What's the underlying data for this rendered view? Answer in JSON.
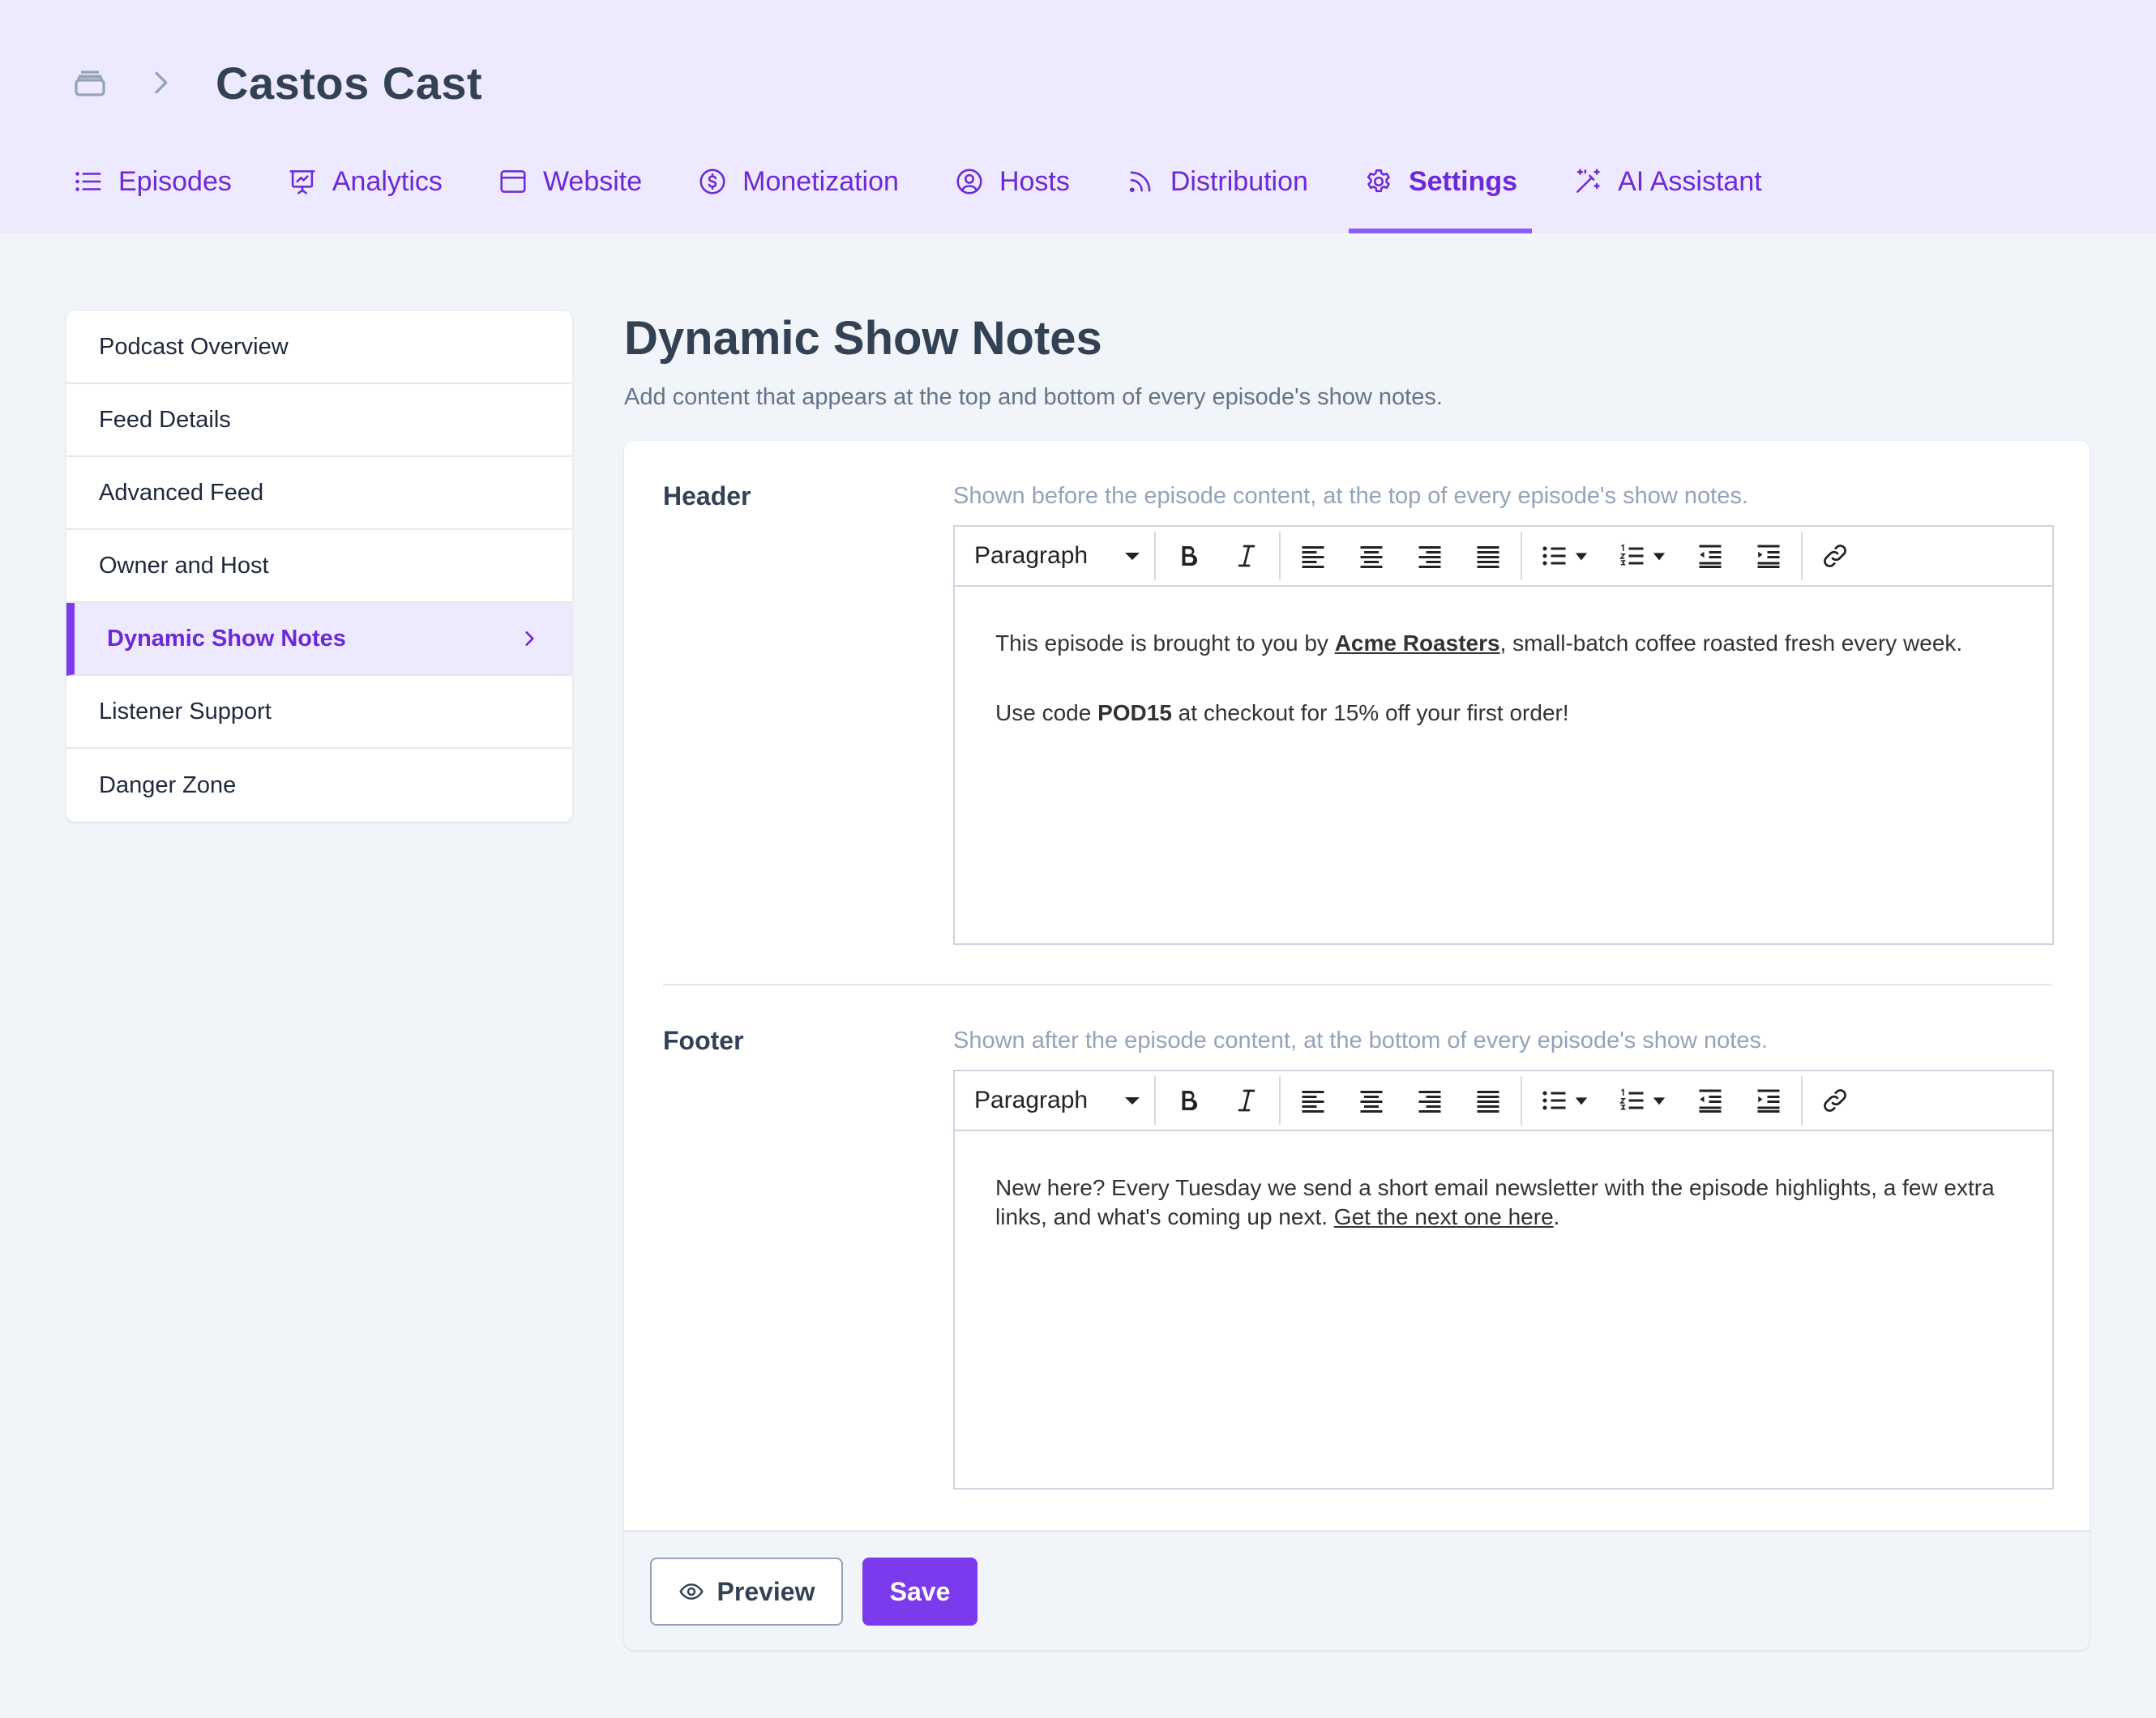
{
  "breadcrumb": {
    "title": "Castos Cast"
  },
  "tabs": [
    {
      "label": "Episodes",
      "icon": "list-icon"
    },
    {
      "label": "Analytics",
      "icon": "presentation-chart-icon"
    },
    {
      "label": "Website",
      "icon": "browser-window-icon"
    },
    {
      "label": "Monetization",
      "icon": "dollar-circle-icon"
    },
    {
      "label": "Hosts",
      "icon": "user-circle-icon"
    },
    {
      "label": "Distribution",
      "icon": "rss-icon"
    },
    {
      "label": "Settings",
      "icon": "gear-icon",
      "active": true
    },
    {
      "label": "AI Assistant",
      "icon": "magic-wand-icon"
    }
  ],
  "sidebar": {
    "items": [
      {
        "label": "Podcast Overview"
      },
      {
        "label": "Feed Details"
      },
      {
        "label": "Advanced Feed"
      },
      {
        "label": "Owner and Host"
      },
      {
        "label": "Dynamic Show Notes",
        "active": true
      },
      {
        "label": "Listener Support"
      },
      {
        "label": "Danger Zone"
      }
    ]
  },
  "main": {
    "title": "Dynamic Show Notes",
    "subtitle": "Add content that appears at the top and bottom of every episode's show notes.",
    "header_section": {
      "label": "Header",
      "help": "Shown before the episode content, at the top of every episode's show notes.",
      "format": "Paragraph",
      "p1_before": "This episode is brought to you by ",
      "p1_link": "Acme Roasters",
      "p1_after": ", small-batch coffee roasted fresh every week.",
      "p2_before": "Use code ",
      "p2_code": "POD15",
      "p2_after": " at checkout for 15% off your first order!"
    },
    "footer_section": {
      "label": "Footer",
      "help": "Shown after the episode content, at the bottom of every episode's show notes.",
      "format": "Paragraph",
      "p1_before": "New here? Every Tuesday we send a short email newsletter with the episode highlights, a few extra links, and what's coming up next. ",
      "p1_link": "Get the next one here",
      "p1_after": "."
    },
    "buttons": {
      "preview": "Preview",
      "save": "Save"
    }
  },
  "colors": {
    "accent": "#7c3aed",
    "tab_text": "#6d28d9",
    "topbar_bg": "#ede9fe",
    "page_bg": "#f1f5f9"
  }
}
